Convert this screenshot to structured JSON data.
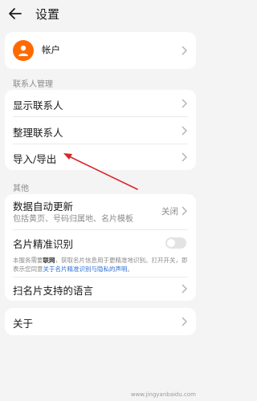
{
  "header": {
    "title": "设置"
  },
  "account": {
    "label": "帐户"
  },
  "contacts_section": {
    "title": "联系人管理",
    "items": [
      {
        "label": "显示联系人"
      },
      {
        "label": "整理联系人"
      },
      {
        "label": "导入/导出"
      }
    ]
  },
  "other_section": {
    "title": "其他",
    "auto_update": {
      "label": "数据自动更新",
      "subtitle": "包括黄页、号码归属地、名片模板",
      "value": "关闭"
    },
    "card_recognition": {
      "label": "名片精准识别",
      "enabled": false
    },
    "notice": {
      "part1": "本服务需要",
      "bold": "联网",
      "part2": "，获取名片信息用于更精准地识别。打开开关，即表示您同意",
      "link": "关于名片精准识别与隐私的声明",
      "part3": "。"
    },
    "scan_language": {
      "label": "扫名片支持的语言"
    }
  },
  "about": {
    "label": "关于"
  },
  "watermark": "www.jingyanbaidu.com",
  "colors": {
    "avatar": "#ff6a00",
    "arrow": "#d8262b",
    "link": "#2f6fd6"
  }
}
